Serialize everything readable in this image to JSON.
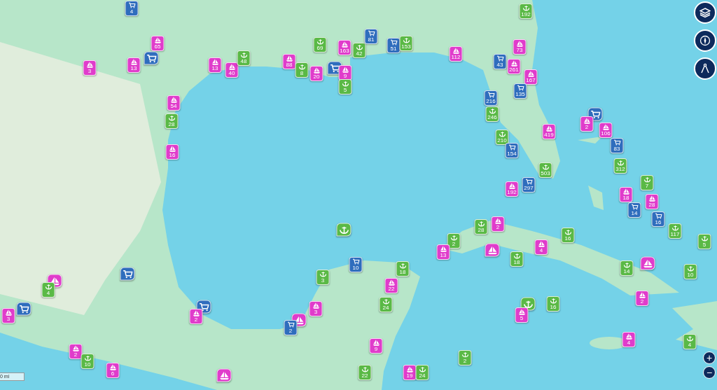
{
  "markers": [
    {
      "kind": "cart",
      "count": "4"
    },
    {
      "kind": "sail",
      "count": "65"
    },
    {
      "kind": "cart"
    },
    {
      "kind": "sail",
      "count": "3"
    },
    {
      "kind": "sail",
      "count": "13"
    },
    {
      "kind": "sail",
      "count": "13"
    },
    {
      "kind": "sail",
      "count": "40"
    },
    {
      "kind": "anchor",
      "count": "48"
    },
    {
      "kind": "sail",
      "count": "88"
    },
    {
      "kind": "anchor",
      "count": "8"
    },
    {
      "kind": "sail",
      "count": "20"
    },
    {
      "kind": "anchor",
      "count": "69"
    },
    {
      "kind": "cart"
    },
    {
      "kind": "sail",
      "count": "163"
    },
    {
      "kind": "anchor",
      "count": "42"
    },
    {
      "kind": "sail",
      "count": "9"
    },
    {
      "kind": "anchor",
      "count": "5"
    },
    {
      "kind": "cart",
      "count": "81"
    },
    {
      "kind": "cart",
      "count": "51"
    },
    {
      "kind": "anchor",
      "count": "153"
    },
    {
      "kind": "sail",
      "count": "112"
    },
    {
      "kind": "anchor",
      "count": "192"
    },
    {
      "kind": "sail",
      "count": "73"
    },
    {
      "kind": "cart",
      "count": "43"
    },
    {
      "kind": "sail",
      "count": "261"
    },
    {
      "kind": "sail",
      "count": "167"
    },
    {
      "kind": "cart",
      "count": "135"
    },
    {
      "kind": "cart",
      "count": "216"
    },
    {
      "kind": "anchor",
      "count": "246"
    },
    {
      "kind": "sail",
      "count": "419"
    },
    {
      "kind": "anchor",
      "count": "210"
    },
    {
      "kind": "cart",
      "count": "154"
    },
    {
      "kind": "anchor",
      "count": "503"
    },
    {
      "kind": "cart"
    },
    {
      "kind": "sail",
      "count": "2"
    },
    {
      "kind": "sail",
      "count": "106"
    },
    {
      "kind": "cart",
      "count": "83"
    },
    {
      "kind": "anchor",
      "count": "312"
    },
    {
      "kind": "sail",
      "count": "192"
    },
    {
      "kind": "cart",
      "count": "297"
    },
    {
      "kind": "anchor",
      "count": "7"
    },
    {
      "kind": "sail",
      "count": "18"
    },
    {
      "kind": "cart",
      "count": "14"
    },
    {
      "kind": "sail",
      "count": "28"
    },
    {
      "kind": "cart",
      "count": "16"
    },
    {
      "kind": "anchor",
      "count": "117"
    },
    {
      "kind": "anchor",
      "count": "5"
    },
    {
      "kind": "sail"
    },
    {
      "kind": "anchor",
      "count": "10"
    },
    {
      "kind": "anchor",
      "count": "14"
    },
    {
      "kind": "anchor",
      "count": "16"
    },
    {
      "kind": "sail",
      "count": "4"
    },
    {
      "kind": "anchor",
      "count": "18"
    },
    {
      "kind": "sail"
    },
    {
      "kind": "anchor",
      "count": "28"
    },
    {
      "kind": "sail",
      "count": "2"
    },
    {
      "kind": "anchor",
      "count": "2"
    },
    {
      "kind": "sail",
      "count": "13"
    },
    {
      "kind": "anchor"
    },
    {
      "kind": "cart",
      "count": "10"
    },
    {
      "kind": "anchor",
      "count": "18"
    },
    {
      "kind": "anchor",
      "count": "3"
    },
    {
      "kind": "sail",
      "count": "22"
    },
    {
      "kind": "anchor",
      "count": "24"
    },
    {
      "kind": "sail",
      "count": "3"
    },
    {
      "kind": "sail"
    },
    {
      "kind": "cart",
      "count": "2"
    },
    {
      "kind": "cart"
    },
    {
      "kind": "sail",
      "count": "2"
    },
    {
      "kind": "cart"
    },
    {
      "kind": "sail"
    },
    {
      "kind": "anchor",
      "count": "4"
    },
    {
      "kind": "cart"
    },
    {
      "kind": "sail",
      "count": "3"
    },
    {
      "kind": "sail",
      "count": "2"
    },
    {
      "kind": "anchor",
      "count": "10"
    },
    {
      "kind": "sail",
      "count": "6"
    },
    {
      "kind": "sail"
    },
    {
      "kind": "sail",
      "count": "9"
    },
    {
      "kind": "anchor",
      "count": "22"
    },
    {
      "kind": "sail",
      "count": "19"
    },
    {
      "kind": "anchor",
      "count": "24"
    },
    {
      "kind": "anchor"
    },
    {
      "kind": "sail",
      "count": "5"
    },
    {
      "kind": "anchor",
      "count": "16"
    },
    {
      "kind": "sail",
      "count": "2"
    },
    {
      "kind": "sail",
      "count": "4"
    },
    {
      "kind": "anchor",
      "count": "4"
    },
    {
      "kind": "anchor",
      "count": "2"
    },
    {
      "kind": "sail",
      "count": "54"
    },
    {
      "kind": "anchor",
      "count": "28"
    },
    {
      "kind": "sail",
      "count": "16"
    }
  ],
  "zoom_in": "+",
  "zoom_out": "−",
  "scale": "0 mi"
}
